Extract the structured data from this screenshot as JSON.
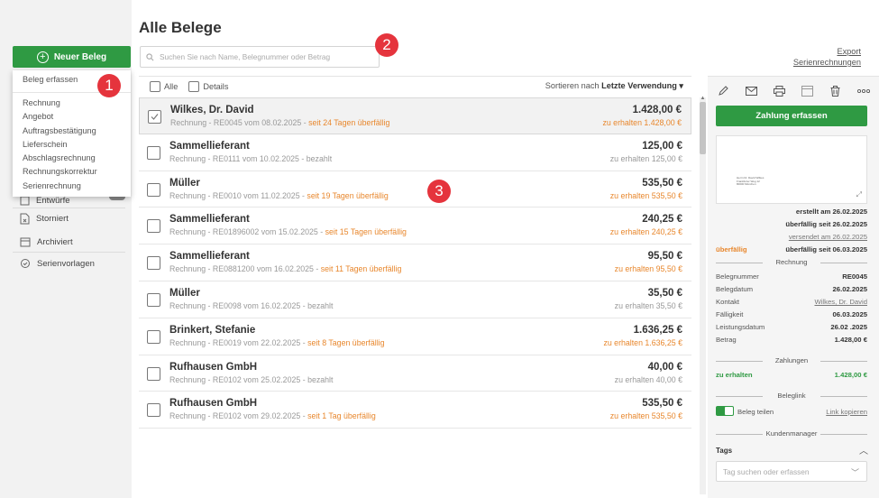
{
  "sidebar": {
    "new_button": "Neuer Beleg",
    "dropdown": {
      "first": "Beleg erfassen",
      "items": [
        "Rechnung",
        "Angebot",
        "Auftragsbestätigung",
        "Lieferschein",
        "Abschlagsrechnung",
        "Rechnungskorrektur",
        "Serienrechnung"
      ]
    },
    "nav": [
      {
        "label": "Entwürfe",
        "icon": "draft-icon"
      },
      {
        "label": "Storniert",
        "icon": "cancelled-document-icon"
      },
      {
        "label": "Archiviert",
        "icon": "archive-box-icon"
      },
      {
        "label": "Serienvorlagen",
        "icon": "recurring-icon"
      }
    ]
  },
  "annotations": [
    "1",
    "2",
    "3"
  ],
  "main": {
    "title": "Alle Belege",
    "search_placeholder": "Suchen Sie nach Name, Belegnummer oder Betrag",
    "export_link": "Export",
    "series_link": "Serienrechnungen",
    "all_label": "Alle",
    "details_label": "Details",
    "sort_prefix": "Sortieren nach",
    "sort_value": "Letzte Verwendung ▾"
  },
  "rows": [
    {
      "name": "Wilkes, Dr. David",
      "desc": "Rechnung - RE0045 vom 08.02.2025 - ",
      "status": "seit 24 Tagen überfällig",
      "overdue": true,
      "amount": "1.428,00 €",
      "receive": "zu erhalten 1.428,00 €",
      "selected": true
    },
    {
      "name": "Sammellieferant",
      "desc": "Rechnung - RE0111 vom 10.02.2025 - ",
      "status": "bezahlt",
      "overdue": false,
      "amount": "125,00 €",
      "receive": "zu erhalten 125,00 €",
      "selected": false
    },
    {
      "name": "Müller",
      "desc": "Rechnung - RE0010 vom 11.02.2025 - ",
      "status": "seit 19 Tagen überfällig",
      "overdue": true,
      "amount": "535,50 €",
      "receive": "zu erhalten 535,50 €",
      "selected": false
    },
    {
      "name": "Sammellieferant",
      "desc": "Rechnung - RE01896002 vom 15.02.2025 - ",
      "status": "seit 15 Tagen überfällig",
      "overdue": true,
      "amount": "240,25 €",
      "receive": "zu erhalten 240,25 €",
      "selected": false
    },
    {
      "name": "Sammellieferant",
      "desc": "Rechnung - RE0881200 vom 16.02.2025 - ",
      "status": "seit 11 Tagen überfällig",
      "overdue": true,
      "amount": "95,50 €",
      "receive": "zu erhalten 95,50 €",
      "selected": false
    },
    {
      "name": "Müller",
      "desc": "Rechnung - RE0098 vom 16.02.2025 - ",
      "status": "bezahlt",
      "overdue": false,
      "amount": "35,50 €",
      "receive": "zu erhalten 35,50 €",
      "selected": false
    },
    {
      "name": "Brinkert, Stefanie",
      "desc": "Rechnung - RE0019 vom 22.02.2025 - ",
      "status": "seit 8 Tagen überfällig",
      "overdue": true,
      "amount": "1.636,25 €",
      "receive": "zu erhalten 1.636,25 €",
      "selected": false
    },
    {
      "name": "Rufhausen GmbH",
      "desc": "Rechnung - RE0102 vom 25.02.2025 - ",
      "status": "bezahlt",
      "overdue": false,
      "amount": "40,00 €",
      "receive": "zu erhalten 40,00 €",
      "selected": false
    },
    {
      "name": "Rufhausen GmbH",
      "desc": "Rechnung - RE0102 vom 29.02.2025 - ",
      "status": "seit 1 Tag überfällig",
      "overdue": true,
      "amount": "535,50 €",
      "receive": "zu erhalten 535,50 €",
      "selected": false
    }
  ],
  "detail": {
    "pay_button": "Zahlung erfassen",
    "preview_text": [
      "Herrn Dr. David Wilkes",
      "Frankfurter Weg 12",
      "80000 München"
    ],
    "created": "erstellt am 26.02.2025",
    "overdue_since": "überfällig seit 26.02.2025",
    "sent": "versendet am 26.02.2025",
    "status_label": "überfällig",
    "overdue_since2": "überfällig seit 06.03.2025",
    "section_invoice": "Rechnung",
    "fields": [
      {
        "label": "Belegnummer",
        "value": "RE0045"
      },
      {
        "label": "Belegdatum",
        "value": "26.02.2025"
      },
      {
        "label": "Kontakt",
        "value": "Wilkes, Dr. David"
      },
      {
        "label": "Fälligkeit",
        "value": "06.03.2025"
      },
      {
        "label": "Leistungsdatum",
        "value": "26.02 .2025"
      },
      {
        "label": "Betrag",
        "value": "1.428,00 €"
      }
    ],
    "section_payments": "Zahlungen",
    "receive_label": "zu erhalten",
    "receive_value": "1.428,00 €",
    "section_link": "Beleglink",
    "share_label": "Beleg teilen",
    "copy_link": "Link kopieren",
    "section_customer": "Kundenmanager",
    "tags_title": "Tags",
    "tags_placeholder": "Tag suchen oder erfassen"
  },
  "colors": {
    "accent": "#2f9a43",
    "overdue": "#e8872d",
    "annotation": "#e5343d"
  }
}
